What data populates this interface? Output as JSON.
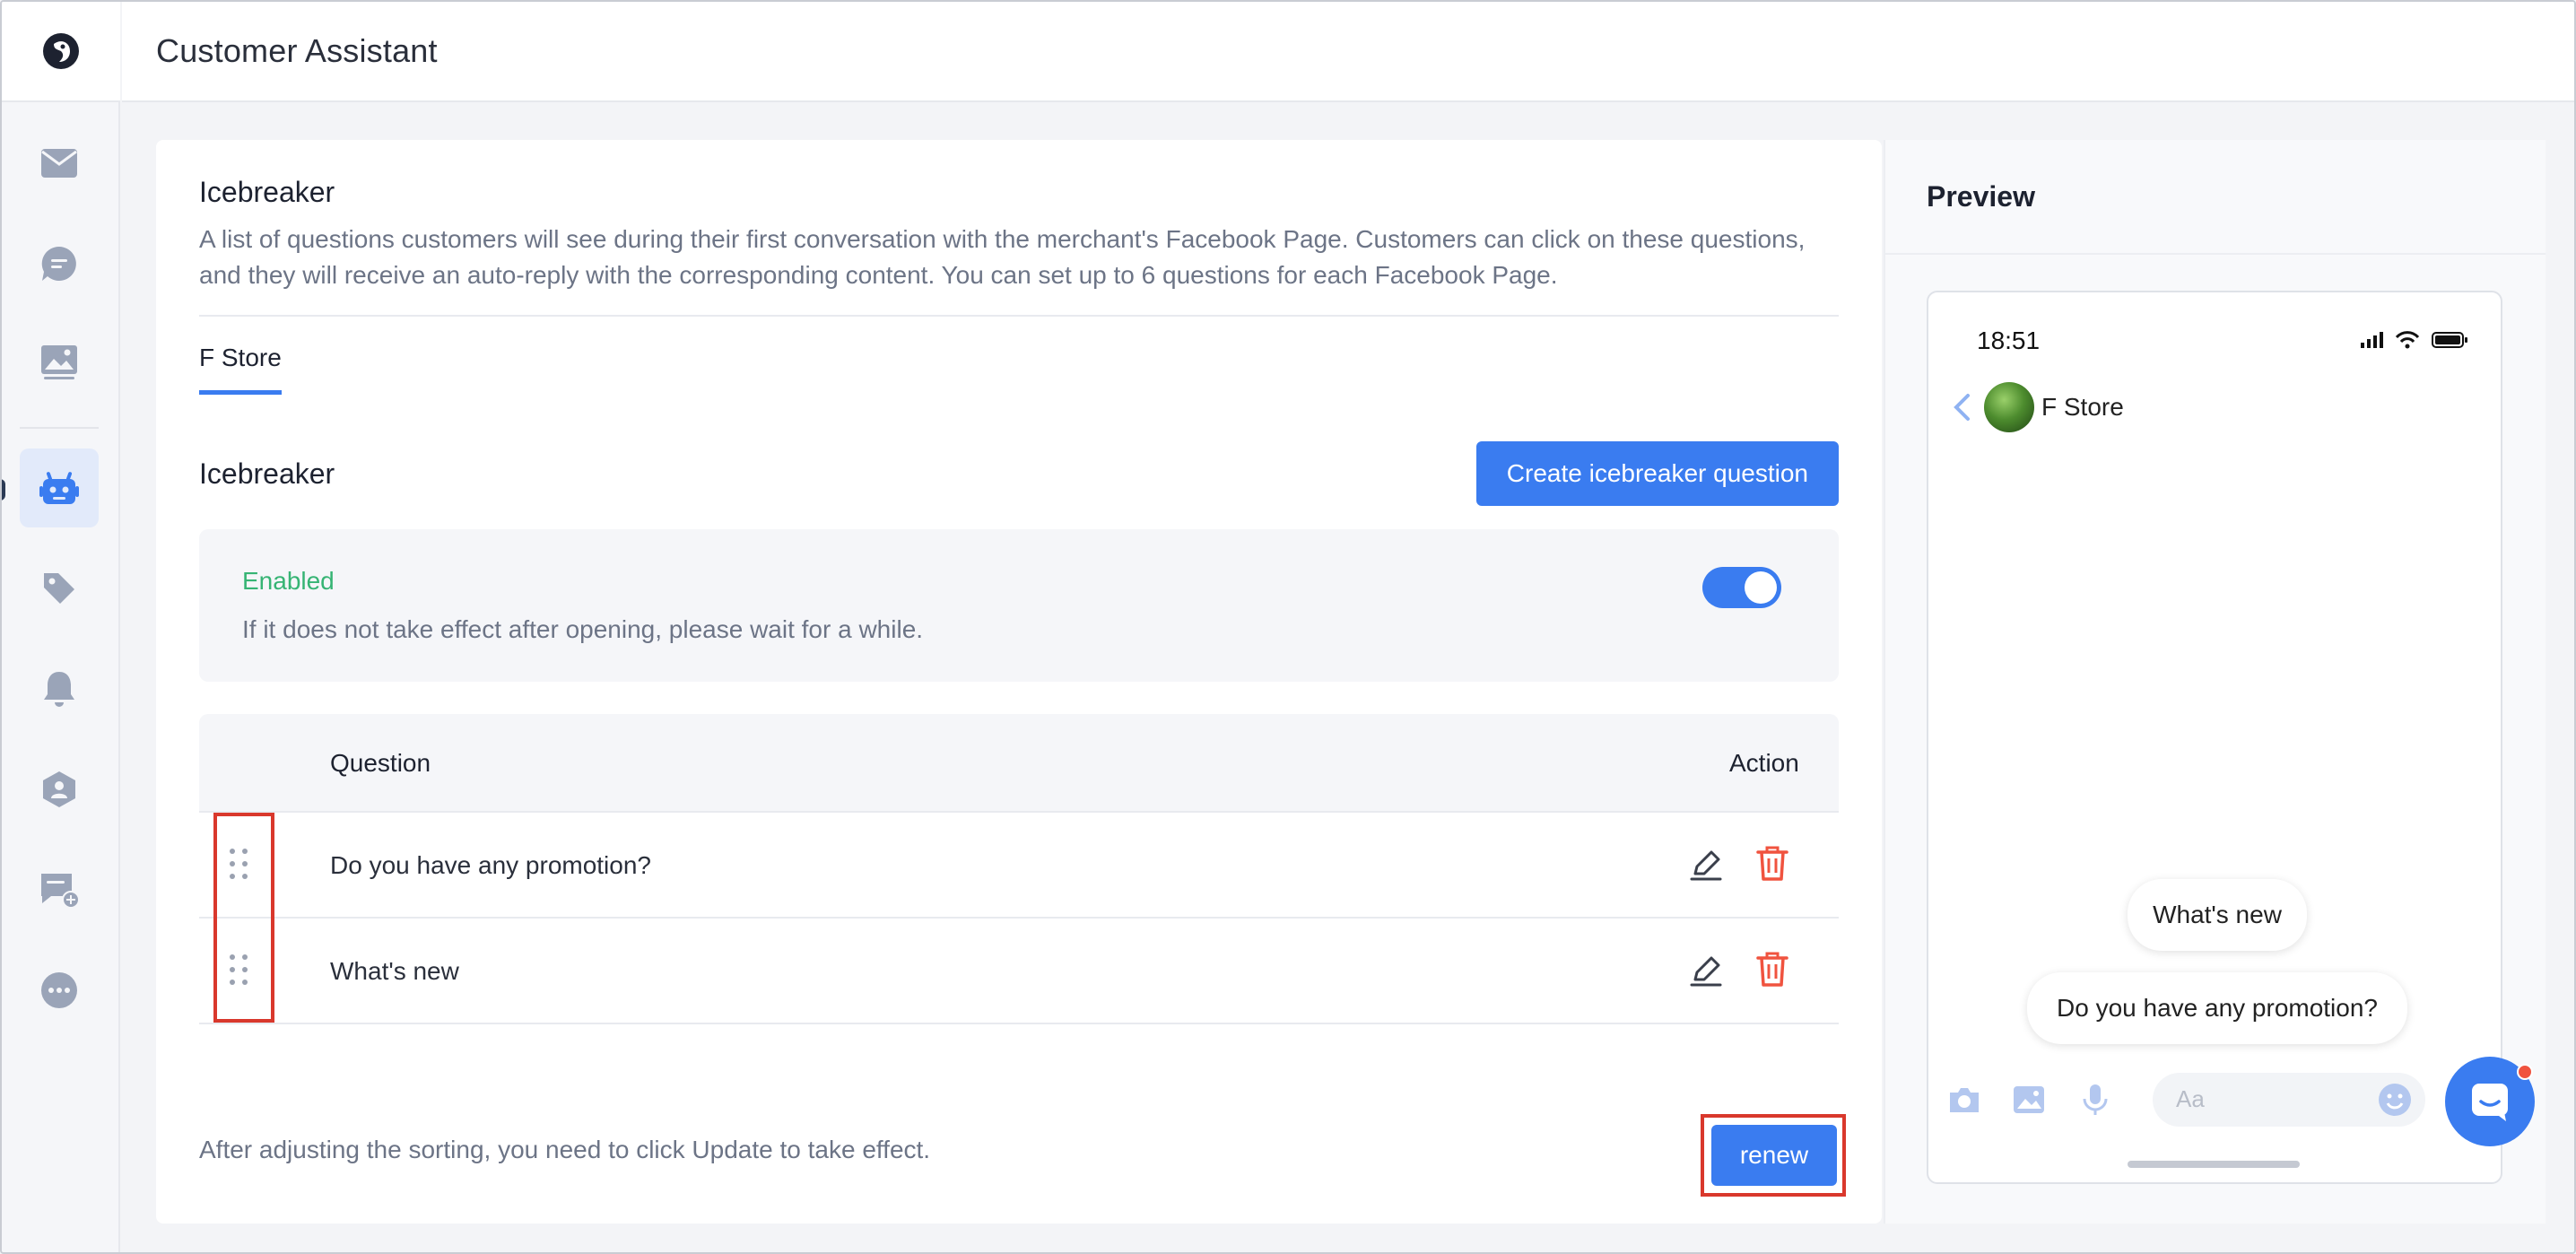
{
  "app": {
    "title": "Customer Assistant"
  },
  "sidebar": {
    "items": [
      {
        "icon": "mail-icon"
      },
      {
        "icon": "chat-bubble-icon"
      },
      {
        "icon": "image-icon"
      },
      {
        "icon": "robot-icon",
        "active": true
      },
      {
        "icon": "tag-icon"
      },
      {
        "icon": "bell-icon"
      },
      {
        "icon": "user-shield-icon"
      },
      {
        "icon": "chat-add-icon"
      },
      {
        "icon": "more-icon"
      }
    ]
  },
  "settings": {
    "title": "Icebreaker",
    "description": "A list of questions customers will see during their first conversation with the merchant's Facebook Page. Customers can click on these questions, and they will receive an auto-reply with the corresponding content. You can set up to 6 questions for each Facebook Page.",
    "tabs": [
      {
        "label": "F Store",
        "active": true
      }
    ],
    "section_title": "Icebreaker",
    "create_button": "Create icebreaker question",
    "status": {
      "title": "Enabled",
      "note": "If it does not take effect after opening, please wait for a while.",
      "enabled": true
    },
    "table": {
      "columns": {
        "question": "Question",
        "action": "Action"
      },
      "rows": [
        {
          "question": "Do you have any promotion?"
        },
        {
          "question": "What's new"
        }
      ]
    },
    "footer_note": "After adjusting the sorting, you need to click Update to take effect.",
    "renew_button": "renew"
  },
  "preview": {
    "title": "Preview",
    "time": "18:51",
    "page_name": "F Store",
    "bubbles": [
      "What's new",
      "Do you have any promotion?"
    ],
    "composer_placeholder": "Aa"
  },
  "colors": {
    "primary": "#3a7cf0",
    "enabled": "#36b474",
    "danger": "#f0533f",
    "highlight": "#d9382c"
  }
}
